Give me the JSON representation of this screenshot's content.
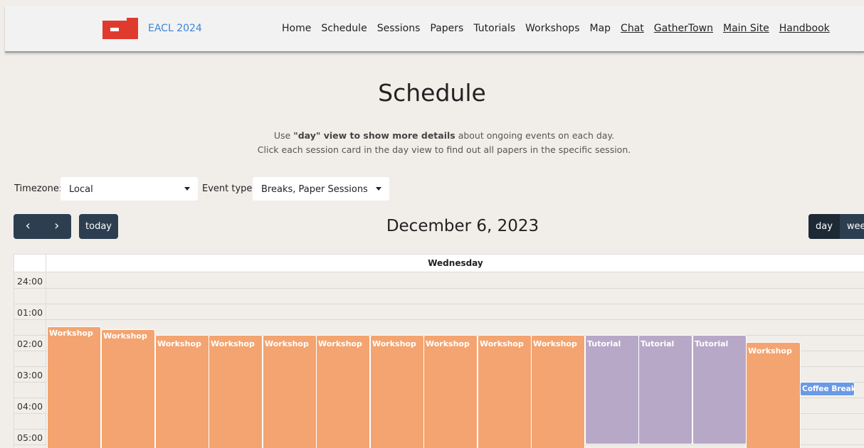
{
  "navbar": {
    "brand": "EACL 2024",
    "links": [
      "Home",
      "Schedule",
      "Sessions",
      "Papers",
      "Tutorials",
      "Workshops",
      "Map",
      "Chat",
      "GatherTown",
      "Main Site",
      "Handbook"
    ],
    "logo_icon": "eacl-logo-icon",
    "logo_color": "#e03a2e"
  },
  "heading": {
    "title": "Schedule",
    "line1_prefix": "Use ",
    "line1_bold": "\"day\" view to show more details",
    "line1_suffix": " about ongoing events on each day.",
    "line2": "Click each session card in the day view to find out all papers in the specific session."
  },
  "filters": {
    "timezone_label": "Timezone:",
    "timezone_value": "Local",
    "event_type_label": "Event type:",
    "event_type_value": "Breaks, Paper Sessions, Pl"
  },
  "toolbar": {
    "prev": "‹",
    "next": "›",
    "today": "today",
    "date": "December 6, 2023",
    "views": [
      "day",
      "week"
    ]
  },
  "calendar": {
    "day_header": "Wednesday",
    "hours": [
      "24:00",
      "01:00",
      "02:00",
      "03:00",
      "04:00",
      "05:00"
    ],
    "events": [
      {
        "label": "Workshop",
        "kind": "workshop"
      },
      {
        "label": "Workshop",
        "kind": "workshop"
      },
      {
        "label": "Workshop",
        "kind": "workshop"
      },
      {
        "label": "Workshop",
        "kind": "workshop"
      },
      {
        "label": "Workshop",
        "kind": "workshop"
      },
      {
        "label": "Workshop",
        "kind": "workshop"
      },
      {
        "label": "Workshop",
        "kind": "workshop"
      },
      {
        "label": "Workshop",
        "kind": "workshop"
      },
      {
        "label": "Workshop",
        "kind": "workshop"
      },
      {
        "label": "Workshop",
        "kind": "workshop"
      },
      {
        "label": "Tutorial",
        "kind": "tutorial"
      },
      {
        "label": "Tutorial",
        "kind": "tutorial"
      },
      {
        "label": "Tutorial",
        "kind": "tutorial"
      },
      {
        "label": "Workshop",
        "kind": "workshop"
      },
      {
        "label": "Coffee Break",
        "kind": "break"
      }
    ],
    "colors": {
      "workshop": "#f3a470",
      "tutorial": "#b8a8c7",
      "break": "#6a9ae6"
    }
  }
}
